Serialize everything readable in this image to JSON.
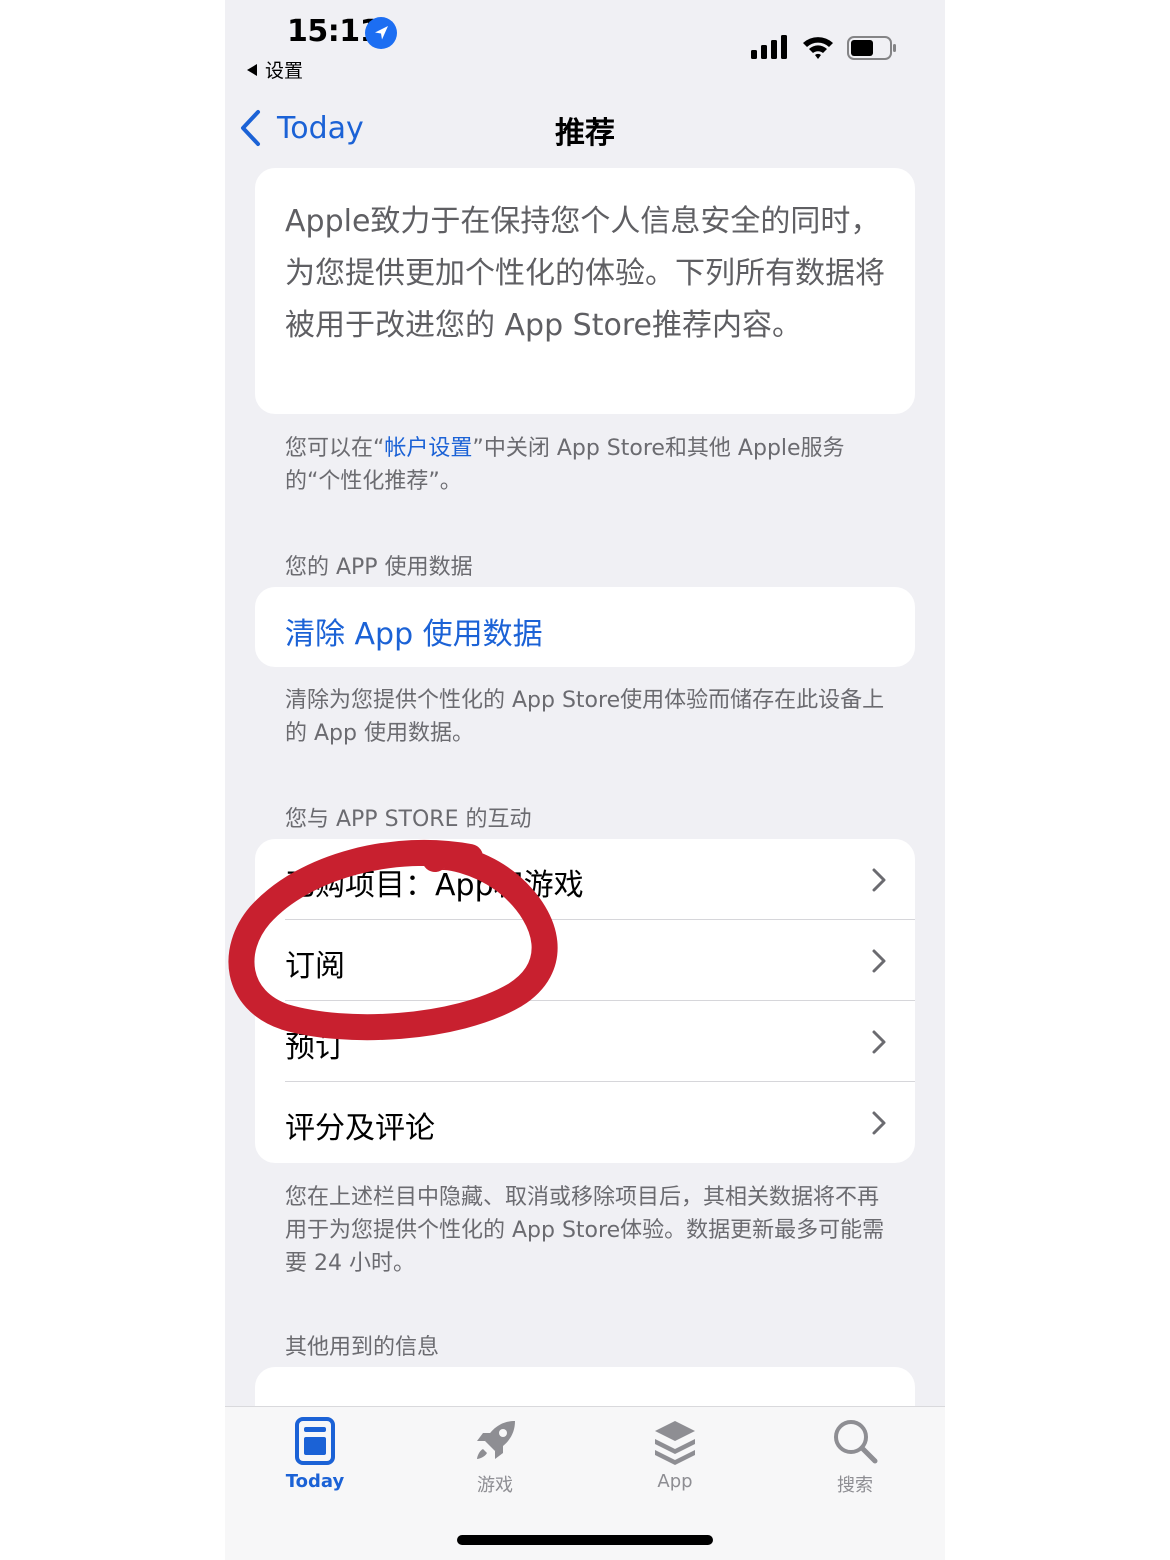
{
  "status_bar": {
    "time": "15:11",
    "back_app": "设置",
    "location_icon": "location-arrow-icon",
    "signal_icon": "cellular-signal-icon",
    "wifi_icon": "wifi-icon",
    "battery_icon": "battery-icon"
  },
  "nav": {
    "back_label": "Today",
    "title": "推荐"
  },
  "intro": {
    "text": "Apple致力于在保持您个人信息安全的同时，为您提供更加个性化的体验。下列所有数据将被用于改进您的 App Store推荐内容。"
  },
  "account_note": {
    "prefix": "您可以在“",
    "link": "帐户设置",
    "suffix": "”中关闭 App Store和其他 Apple服务的“个性化推荐”。"
  },
  "app_usage": {
    "header": "您的 APP 使用数据",
    "clear_button": "清除 App 使用数据",
    "footer": "清除为您提供个性化的 App Store使用体验而储存在此设备上的 App 使用数据。"
  },
  "interactions": {
    "header": "您与 APP STORE 的互动",
    "items": [
      {
        "label": "已购项目：App和游戏"
      },
      {
        "label": "订阅"
      },
      {
        "label": "预订"
      },
      {
        "label": "评分及评论"
      }
    ],
    "footer": "您在上述栏目中隐藏、取消或移除项目后，其相关数据将不再用于为您提供个性化的 App Store体验。数据更新最多可能需要 24 小时。"
  },
  "other_info": {
    "header": "其他用到的信息"
  },
  "annotation": {
    "color": "#c8202f",
    "target": "订阅"
  },
  "tabbar": {
    "tabs": [
      {
        "label": "Today",
        "icon": "today-icon",
        "active": true
      },
      {
        "label": "游戏",
        "icon": "rocket-icon",
        "active": false
      },
      {
        "label": "App",
        "icon": "app-stack-icon",
        "active": false
      },
      {
        "label": "搜索",
        "icon": "search-icon",
        "active": false
      }
    ]
  },
  "colors": {
    "accent": "#1b62d6",
    "background": "#f0f0f4",
    "card": "#ffffff",
    "secondary_text": "#6b6b70"
  }
}
